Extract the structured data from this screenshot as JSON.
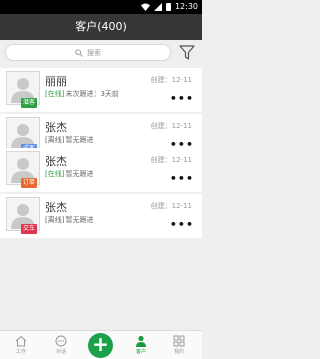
{
  "status_bar": {
    "time": "12:30"
  },
  "header": {
    "title": "客户(400)"
  },
  "search": {
    "placeholder": "搜索"
  },
  "customers": [
    {
      "name": "丽丽",
      "badge": "潜客",
      "badge_color": "#2ea043",
      "status_tag": "[在线]",
      "status_text": "末次跟进：3天前",
      "status_color": "#2ea043",
      "created": "创建：12-11"
    },
    {
      "name": "张杰",
      "badge": "成客",
      "badge_color": "#5b8ce6",
      "status_tag": "[离线]",
      "status_text": "暂无跟进",
      "status_color": "#666666",
      "created": "创建：12-11"
    },
    {
      "name": "张杰",
      "badge": "订单",
      "badge_color": "#e8692d",
      "status_tag": "[在线]",
      "status_text": "暂无跟进",
      "status_color": "#2ea043",
      "created": "创建：12-11"
    },
    {
      "name": "张杰",
      "badge": "交车",
      "badge_color": "#e0334e",
      "status_tag": "[离线]",
      "status_text": "暂无跟进",
      "status_color": "#666666",
      "created": "创建：12-11"
    }
  ],
  "more_label": "•••",
  "tabbar": {
    "items": [
      {
        "label": "工作",
        "icon": "home-icon"
      },
      {
        "label": "对话",
        "icon": "chat-icon"
      },
      {
        "label": "客户",
        "icon": "person-icon",
        "active": true
      },
      {
        "label": "我的",
        "icon": "grid-icon"
      }
    ],
    "add_label": "+"
  },
  "colors": {
    "accent": "#1aa14a",
    "header_bg": "#363636"
  }
}
